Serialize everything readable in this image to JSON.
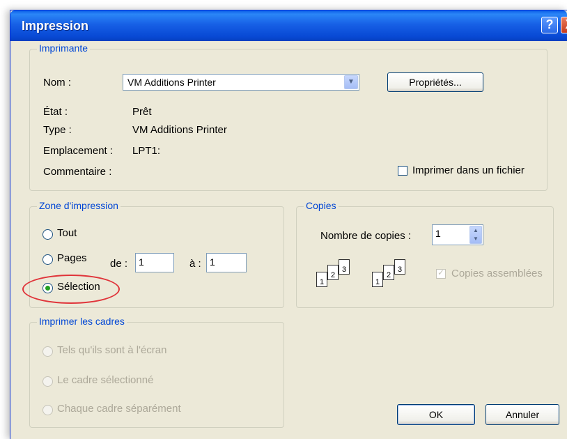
{
  "window": {
    "title": "Impression"
  },
  "titlebar": {
    "help_icon": "?",
    "close_icon": "X"
  },
  "printer": {
    "legend": "Imprimante",
    "name_label": "Nom :",
    "name_value": "VM Additions Printer",
    "properties_button": "Propriétés...",
    "state_label": "État :",
    "state_value": "Prêt",
    "type_label": "Type :",
    "type_value": "VM Additions Printer",
    "location_label": "Emplacement :",
    "location_value": "LPT1:",
    "comment_label": "Commentaire :",
    "print_to_file_label": "Imprimer dans un fichier"
  },
  "range": {
    "legend": "Zone d'impression",
    "all_label": "Tout",
    "pages_label": "Pages",
    "from_label": "de :",
    "from_value": "1",
    "to_label": "à :",
    "to_value": "1",
    "selection_label": "Sélection",
    "selected_option": "Sélection"
  },
  "copies": {
    "legend": "Copies",
    "count_label": "Nombre de copies :",
    "count_value": "1",
    "collate_label": "Copies assemblées",
    "page_numbers": [
      "1",
      "2",
      "3"
    ]
  },
  "frames": {
    "legend": "Imprimer les cadres",
    "option1": "Tels qu'ils sont à l'écran",
    "option2": "Le cadre sélectionné",
    "option3": "Chaque cadre séparément"
  },
  "buttons": {
    "ok": "OK",
    "cancel": "Annuler"
  }
}
